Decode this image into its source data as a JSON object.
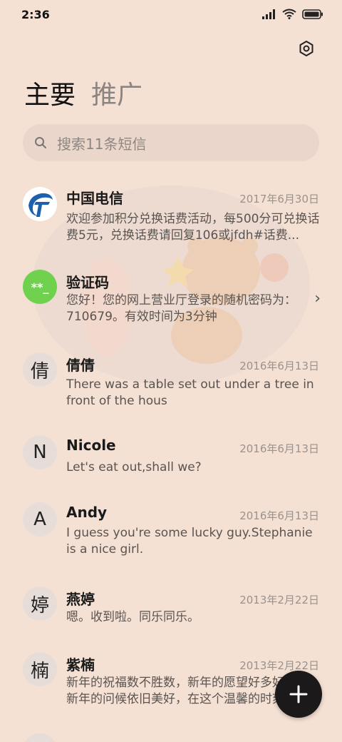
{
  "status": {
    "time": "2:36"
  },
  "tabs": [
    {
      "label": "主要"
    },
    {
      "label": "推广"
    }
  ],
  "search": {
    "placeholder": "搜索11条短信"
  },
  "conversations": [
    {
      "name": "中国电信",
      "date": "2017年6月30日",
      "preview": "欢迎参加积分兑换话费活动，每500分可兑换话费5元，兑换话费请回复106或jfdh#话费...",
      "avatar_char": ""
    },
    {
      "name": "验证码",
      "date": "",
      "preview": "您好！您的网上营业厅登录的随机密码为：710679。有效时间为3分钟",
      "avatar_char": "**_"
    },
    {
      "name": "倩倩",
      "date": "2016年6月13日",
      "preview": "There was a table set out under a tree in front of the hous",
      "avatar_char": "倩"
    },
    {
      "name": "Nicole",
      "date": "2016年6月13日",
      "preview": "Let's eat out,shall we?",
      "avatar_char": "N"
    },
    {
      "name": "Andy",
      "date": "2016年6月13日",
      "preview": "I guess you're some lucky guy.Stephanie is a nice girl.",
      "avatar_char": "A"
    },
    {
      "name": "燕婷",
      "date": "2013年2月22日",
      "preview": "嗯。收到啦。同乐同乐。",
      "avatar_char": "婷"
    },
    {
      "name": "紫楠",
      "date": "2013年2月22日",
      "preview": "新年的祝福数不胜数，新年的愿望好多好多，新年的问候依旧美好，在这个温馨的时刻",
      "avatar_char": "楠"
    }
  ],
  "colors": {
    "background": "#f5e0d4",
    "verify_avatar": "#6fd14d",
    "telecom_blue": "#1e5fae"
  }
}
